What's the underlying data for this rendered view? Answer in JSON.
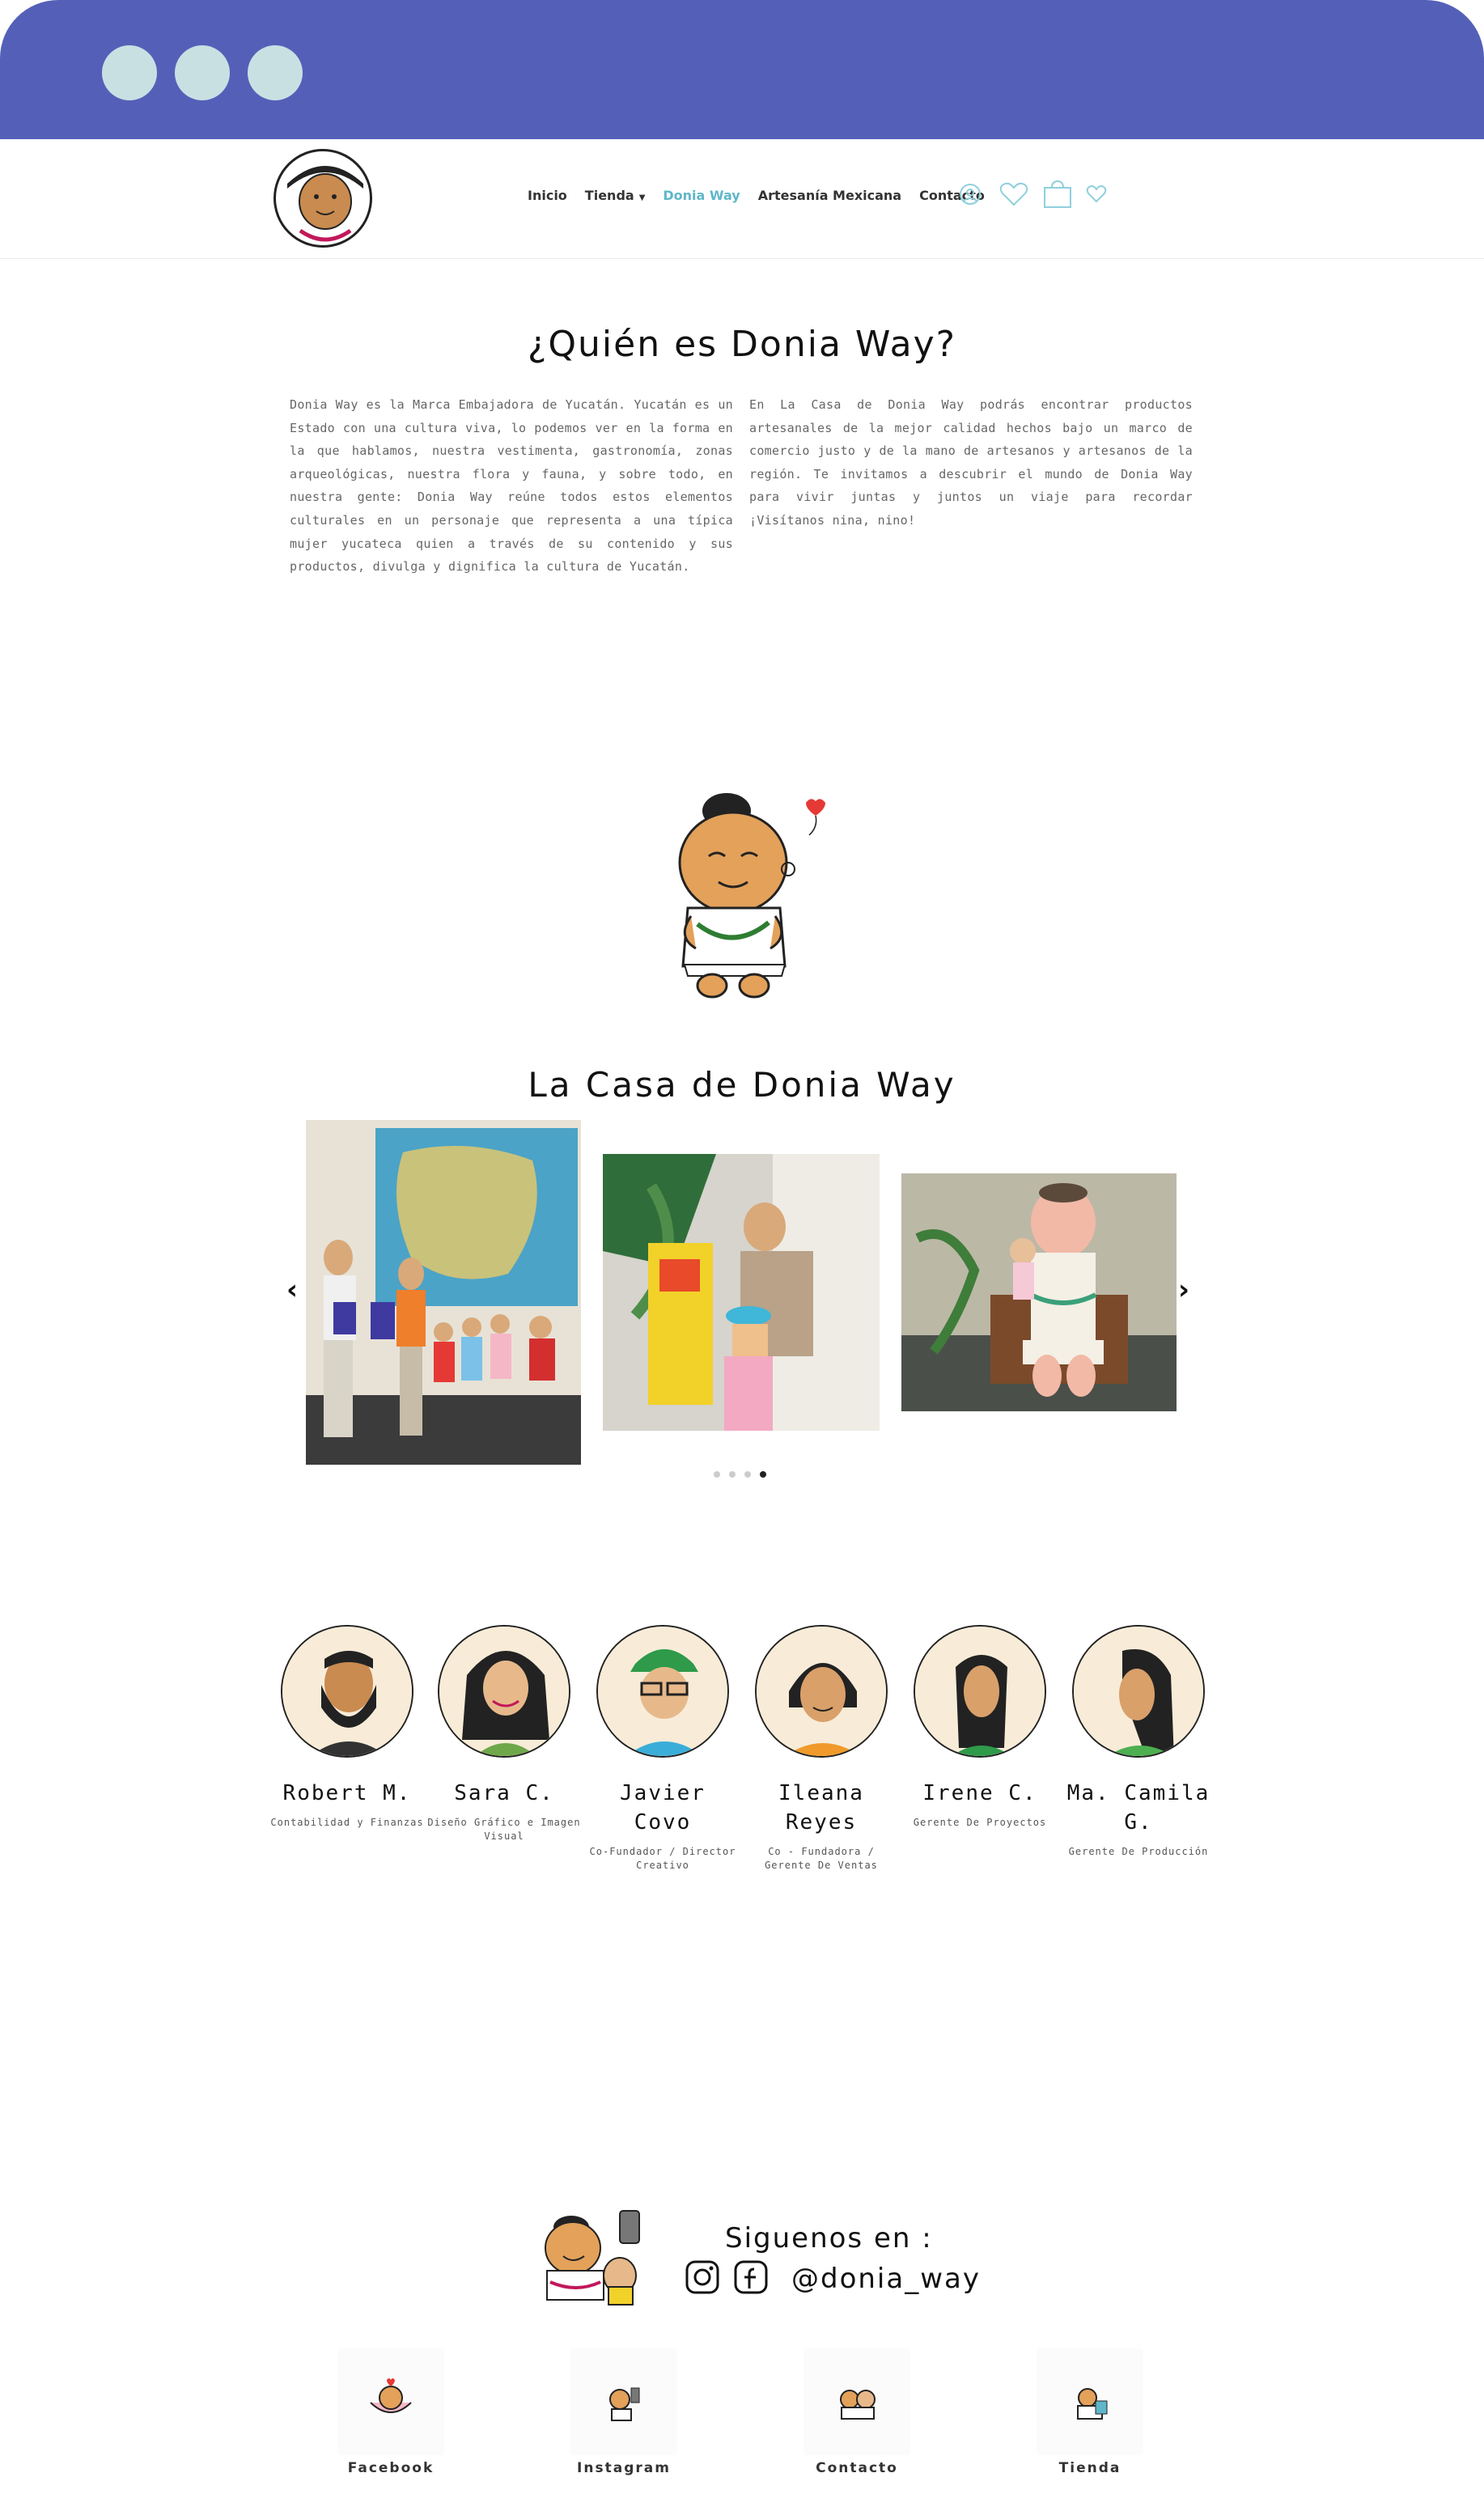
{
  "nav": {
    "items": [
      {
        "label": "Inicio"
      },
      {
        "label": "Tienda"
      },
      {
        "label": "Donia Way"
      },
      {
        "label": "Artesanía Mexicana"
      },
      {
        "label": "Contacto"
      }
    ],
    "active_color": "#5fb7c9"
  },
  "about": {
    "title": "¿Quién es Donia Way?",
    "left_text": "Donia Way es la Marca Embajadora de Yucatán. Yucatán es un Estado con una cultura viva, lo podemos ver en la forma en la que hablamos, nuestra vestimenta, gastronomía, zonas arqueológicas, nuestra flora y fauna, y sobre todo, en nuestra gente: Donia Way reúne todos estos elementos culturales en un personaje que representa a una típica mujer yucateca quien a través de su contenido y sus productos, divulga y dignifica la cultura de Yucatán.",
    "right_text": "En La Casa de Donia Way podrás encontrar productos artesanales de la mejor calidad hechos bajo un marco de comercio justo y de la mano de artesanos y artesanos de la región. Te invitamos a descubrir el mundo de Donia Way para vivir juntas y juntos un viaje para recordar ¡Visítanos nina, nino!"
  },
  "casa": {
    "title": "La Casa de Donia Way",
    "slides_total": 4,
    "active_slide": 4
  },
  "team": [
    {
      "name": "Robert M.",
      "role": "Contabilidad y Finanzas"
    },
    {
      "name": "Sara C.",
      "role": "Diseño Gráfico e Imagen Visual"
    },
    {
      "name": "Javier Covo",
      "role": "Co-Fundador / Director Creativo"
    },
    {
      "name": "Ileana Reyes",
      "role": "Co - Fundadora / Gerente De Ventas"
    },
    {
      "name": "Irene C.",
      "role": "Gerente De Proyectos"
    },
    {
      "name": "Ma. Camila G.",
      "role": "Gerente De Producción"
    }
  ],
  "follow": {
    "title": "Siguenos en :",
    "handle": "@donia_way"
  },
  "footer_links": [
    {
      "label": "Facebook"
    },
    {
      "label": "Instagram"
    },
    {
      "label": "Contacto"
    },
    {
      "label": "Tienda"
    }
  ],
  "colors": {
    "chrome": "#5460b8",
    "chrome_dots": "#c9e0e3",
    "accent": "#5fb7c9"
  }
}
